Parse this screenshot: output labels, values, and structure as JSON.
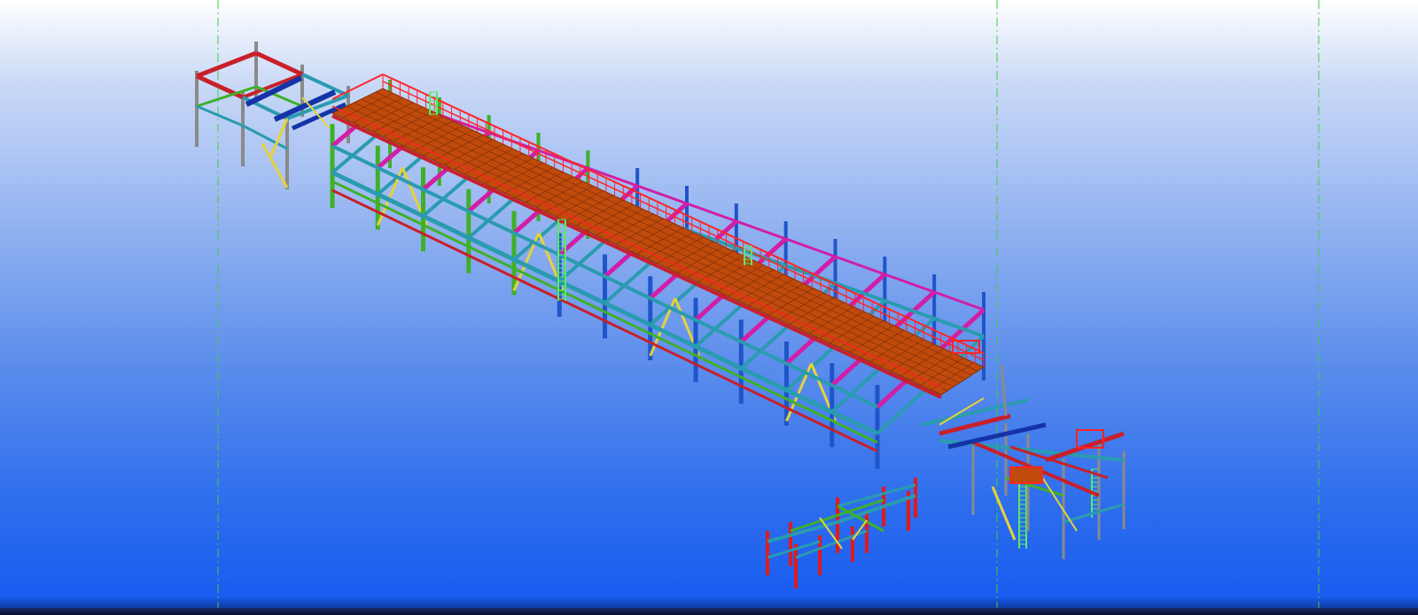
{
  "viewport": {
    "mode": "3d-model-view",
    "background": {
      "top": "#ffffff",
      "bottom": "#1a5cf0"
    }
  },
  "model": {
    "type": "steel-structure-pipe-rack",
    "colors": {
      "deck": "#c04a0c",
      "deck_grid": "#7a2a05",
      "handrail": "#ff2424",
      "column_blue": "#1f55c8",
      "column_green": "#3fb02a",
      "column_gray": "#8a8a8a",
      "column_red": "#e01a1a",
      "beam_cyan": "#2a9bb0",
      "beam_red": "#c8202a",
      "beam_magenta": "#d21ea6",
      "beam_darkblue": "#1533a8",
      "brace_yellow": "#e6d23a",
      "ladder": "#58e868",
      "grid_line": "#3fcf3f"
    }
  }
}
